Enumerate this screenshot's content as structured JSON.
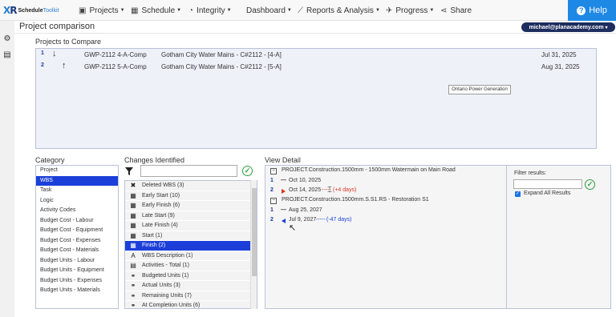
{
  "app": {
    "logo_mark": "X",
    "logo_mark_accent": "R",
    "logo_bold": "Schedule",
    "logo_light": "Toolkit"
  },
  "nav": {
    "projects": "Projects",
    "schedule": "Schedule",
    "integrity": "Integrity",
    "dashboard": "Dashboard",
    "reports": "Reports & Analysis",
    "progress": "Progress",
    "share": "Share",
    "help": "Help"
  },
  "page": {
    "title": "Project comparison",
    "user": "michael@planacademy.com"
  },
  "compare": {
    "label": "Projects to Compare",
    "rows": [
      {
        "num": "1",
        "arrow": "↓",
        "code": "GWP-2112 4-A-Comp",
        "desc": "Gotham City Water Mains - C#2112 - [4-A]",
        "date": "Jul 31, 2025"
      },
      {
        "num": "2",
        "arrow": "↑",
        "code": "GWP-2112 5-A-Comp",
        "desc": "Gotham City Water Mains - C#2112 - [5-A]",
        "date": "Aug 31, 2025"
      }
    ],
    "tooltip": "Ontario Power Generation"
  },
  "category": {
    "label": "Category",
    "items": [
      "Project",
      "WBS",
      "Task",
      "Logic",
      "Activity Codes",
      "Budget Cost - Labour",
      "Budget Cost - Equipment",
      "Budget Cost - Expenses",
      "Budget Cost - Materials",
      "Budget Units - Labour",
      "Budget Units - Equipment",
      "Budget Units - Expenses",
      "Budget Units - Materials"
    ],
    "selected_index": 1
  },
  "changes": {
    "label": "Changes Identified",
    "filter_value": "",
    "items": [
      {
        "icon": "✖",
        "label": "Deleted WBS (3)"
      },
      {
        "icon": "▦",
        "label": "Early Start (10)"
      },
      {
        "icon": "▦",
        "label": "Early Finish (6)"
      },
      {
        "icon": "▦",
        "label": "Late Start (9)"
      },
      {
        "icon": "▦",
        "label": "Late Finish (4)"
      },
      {
        "icon": "▦",
        "label": "Start (1)"
      },
      {
        "icon": "▦",
        "label": "Finish (2)"
      },
      {
        "icon": "A",
        "label": "WBS Description (1)"
      },
      {
        "icon": "▤",
        "label": "Activities - Total (1)"
      },
      {
        "icon": "⚭",
        "label": "Budgeted Units (1)"
      },
      {
        "icon": "⚭",
        "label": "Actual Units (3)"
      },
      {
        "icon": "⚭",
        "label": "Remaining Units (7)"
      },
      {
        "icon": "⚭",
        "label": "At Completion Units (6)"
      }
    ],
    "selected_index": 6
  },
  "detail": {
    "label": "View Detail",
    "groups": [
      {
        "title": "PROJECT.Construction.1500mm - 1500mm Watermain on Main Road",
        "rows": [
          {
            "num": "1",
            "value": "Oct 10, 2025",
            "delta": ""
          },
          {
            "num": "2",
            "value": "Oct 14, 2025",
            "delta": "(+4 days)"
          }
        ]
      },
      {
        "title": "PROJECT.Construction.1500mm.S.S1.RS - Restoration S1",
        "rows": [
          {
            "num": "1",
            "value": "Aug 25, 2027",
            "delta": ""
          },
          {
            "num": "2",
            "value": "Jul 9, 2027",
            "delta": "(-47 days)"
          }
        ]
      }
    ]
  },
  "filter_results": {
    "label": "Filter results:",
    "value": "",
    "expand_label": "Expand All Results",
    "expand_checked": true
  },
  "colors": {
    "accent": "#1b3fd8",
    "help_bg": "#1e88e5",
    "user_badge": "#1d2d5e",
    "positive_delta": "#d32",
    "negative_delta": "#1b3fd8",
    "ok": "#2e9e3e"
  }
}
